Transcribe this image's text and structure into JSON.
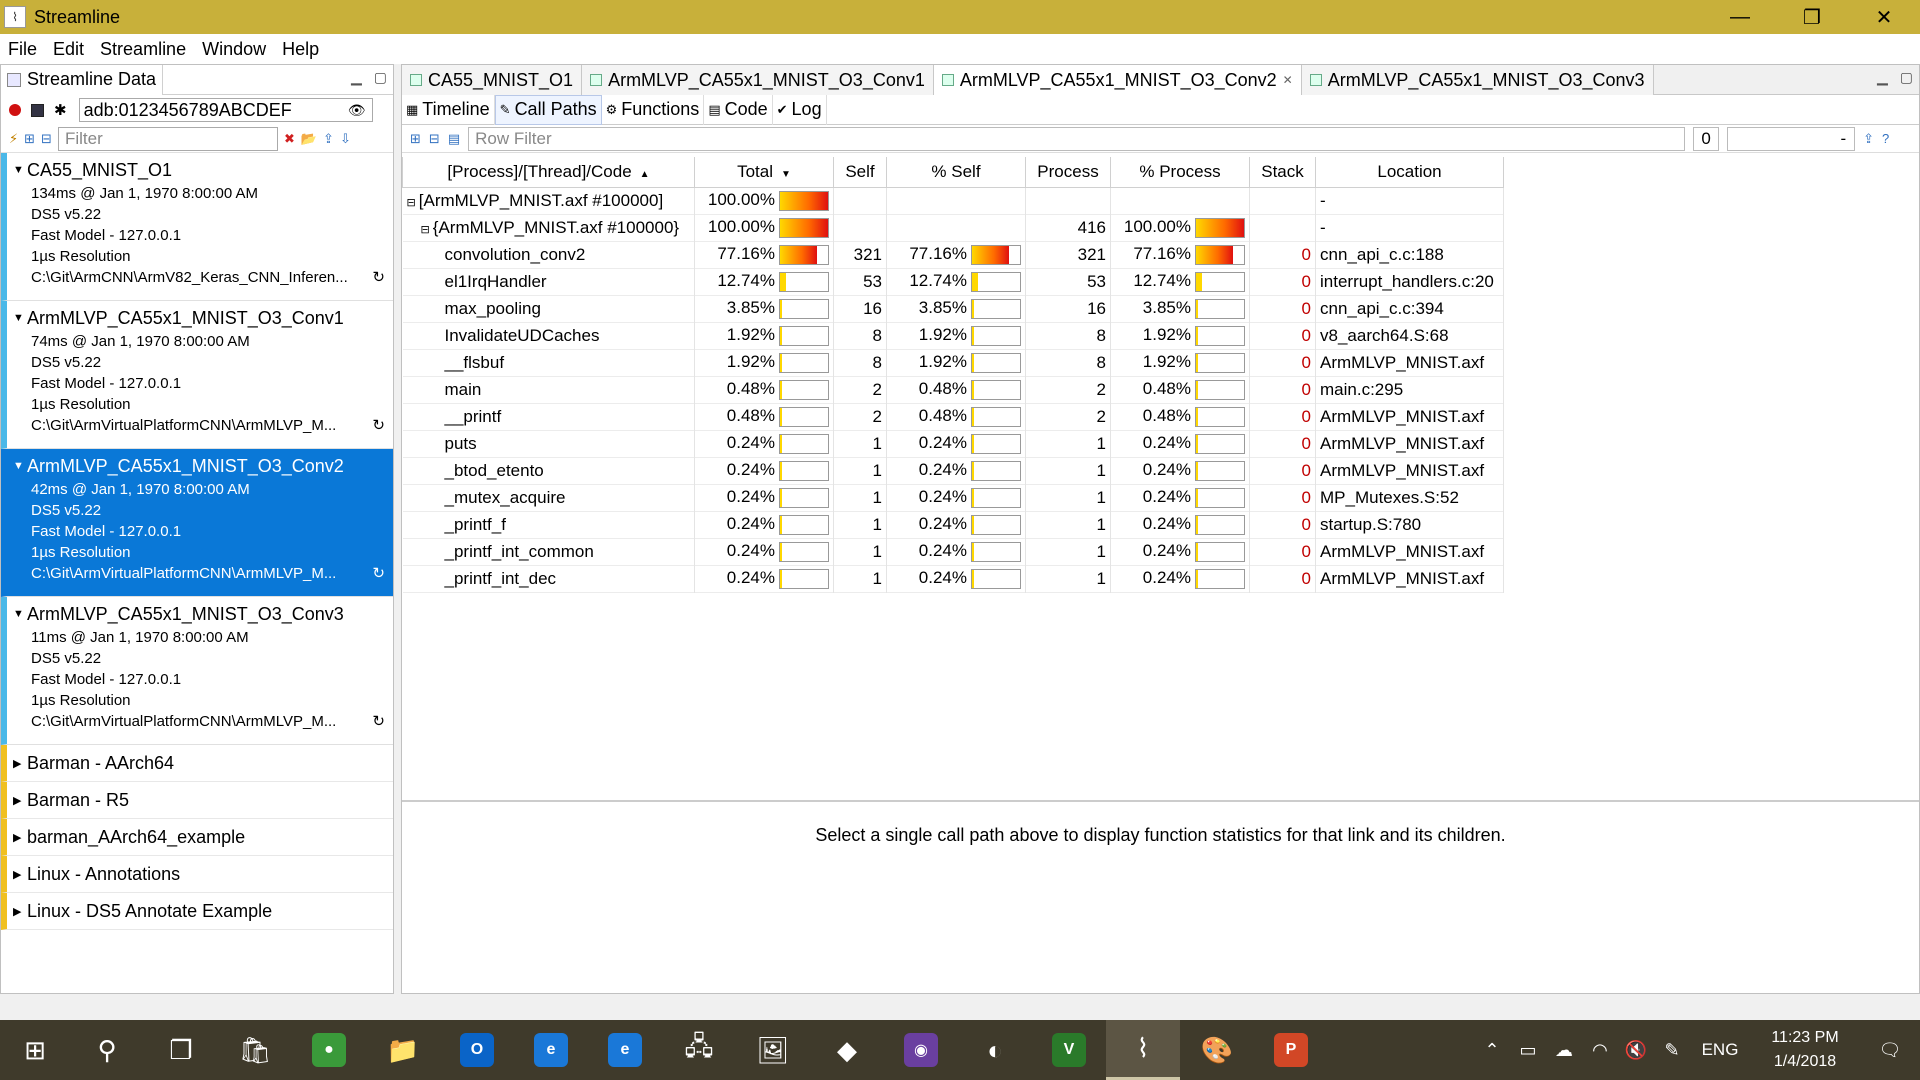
{
  "window": {
    "title": "Streamline",
    "minimize_glyph": "—",
    "maximize_glyph": "❐",
    "close_glyph": "✕"
  },
  "menu": [
    "File",
    "Edit",
    "Streamline",
    "Window",
    "Help"
  ],
  "left_panel": {
    "tab_label": "Streamline Data",
    "device": "adb:0123456789ABCDEF",
    "filter_placeholder": "Filter",
    "captures": [
      {
        "title": "CA55_MNIST_O1",
        "duration": "134ms @ Jan 1, 1970 8:00:00 AM",
        "version": "DS5 v5.22",
        "target": "Fast Model - 127.0.0.1",
        "resolution": "1µs Resolution",
        "path": "C:\\Git\\ArmCNN\\ArmV82_Keras_CNN_Inferen...",
        "selected": false
      },
      {
        "title": "ArmMLVP_CA55x1_MNIST_O3_Conv1",
        "duration": "74ms @ Jan 1, 1970 8:00:00 AM",
        "version": "DS5 v5.22",
        "target": "Fast Model - 127.0.0.1",
        "resolution": "1µs Resolution",
        "path": "C:\\Git\\ArmVirtualPlatformCNN\\ArmMLVP_M...",
        "selected": false
      },
      {
        "title": "ArmMLVP_CA55x1_MNIST_O3_Conv2",
        "duration": "42ms @ Jan 1, 1970 8:00:00 AM",
        "version": "DS5 v5.22",
        "target": "Fast Model - 127.0.0.1",
        "resolution": "1µs Resolution",
        "path": "C:\\Git\\ArmVirtualPlatformCNN\\ArmMLVP_M...",
        "selected": true
      },
      {
        "title": "ArmMLVP_CA55x1_MNIST_O3_Conv3",
        "duration": "11ms @ Jan 1, 1970 8:00:00 AM",
        "version": "DS5 v5.22",
        "target": "Fast Model - 127.0.0.1",
        "resolution": "1µs Resolution",
        "path": "C:\\Git\\ArmVirtualPlatformCNN\\ArmMLVP_M...",
        "selected": false
      }
    ],
    "groups": [
      "Barman - AArch64",
      "Barman - R5",
      "barman_AArch64_example",
      "Linux - Annotations",
      "Linux - DS5 Annotate Example"
    ]
  },
  "doc_tabs": [
    {
      "label": "CA55_MNIST_O1",
      "active": false
    },
    {
      "label": "ArmMLVP_CA55x1_MNIST_O3_Conv1",
      "active": false
    },
    {
      "label": "ArmMLVP_CA55x1_MNIST_O3_Conv2",
      "active": true
    },
    {
      "label": "ArmMLVP_CA55x1_MNIST_O3_Conv3",
      "active": false
    }
  ],
  "view_tabs": [
    {
      "label": "Timeline",
      "active": false
    },
    {
      "label": "Call Paths",
      "active": true
    },
    {
      "label": "Functions",
      "active": false
    },
    {
      "label": "Code",
      "active": false
    },
    {
      "label": "Log",
      "active": false
    }
  ],
  "row_filter_placeholder": "Row Filter",
  "row_filter_count": "0",
  "row_filter_dropdown": "-",
  "table": {
    "headers": [
      "[Process]/[Thread]/Code",
      "Total",
      "Self",
      "% Self",
      "Process",
      "% Process",
      "Stack",
      "Location"
    ],
    "rows": [
      {
        "name": "[ArmMLVP_MNIST.axf #100000]",
        "indent": 0,
        "expander": "⊟",
        "total": "100.00%",
        "total_frac": 1.0,
        "self": "",
        "pself": "",
        "pself_frac": null,
        "process": "",
        "pprocess": "",
        "pprocess_frac": null,
        "stack": "",
        "location": "-"
      },
      {
        "name": "{ArmMLVP_MNIST.axf #100000}",
        "indent": 1,
        "expander": "⊟",
        "total": "100.00%",
        "total_frac": 1.0,
        "self": "",
        "pself": "",
        "pself_frac": null,
        "process": "416",
        "pprocess": "100.00%",
        "pprocess_frac": 1.0,
        "stack": "",
        "location": "-"
      },
      {
        "name": "convolution_conv2",
        "indent": 2,
        "expander": "",
        "total": "77.16%",
        "total_frac": 0.7716,
        "self": "321",
        "pself": "77.16%",
        "pself_frac": 0.7716,
        "process": "321",
        "pprocess": "77.16%",
        "pprocess_frac": 0.7716,
        "stack": "0",
        "location": "cnn_api_c.c:188"
      },
      {
        "name": "el1IrqHandler",
        "indent": 2,
        "expander": "",
        "total": "12.74%",
        "total_frac": 0.1274,
        "self": "53",
        "pself": "12.74%",
        "pself_frac": 0.1274,
        "process": "53",
        "pprocess": "12.74%",
        "pprocess_frac": 0.1274,
        "stack": "0",
        "location": "interrupt_handlers.c:20"
      },
      {
        "name": "max_pooling",
        "indent": 2,
        "expander": "",
        "total": "3.85%",
        "total_frac": 0.0385,
        "self": "16",
        "pself": "3.85%",
        "pself_frac": 0.0385,
        "process": "16",
        "pprocess": "3.85%",
        "pprocess_frac": 0.0385,
        "stack": "0",
        "location": "cnn_api_c.c:394"
      },
      {
        "name": "InvalidateUDCaches",
        "indent": 2,
        "expander": "",
        "total": "1.92%",
        "total_frac": 0.0192,
        "self": "8",
        "pself": "1.92%",
        "pself_frac": 0.0192,
        "process": "8",
        "pprocess": "1.92%",
        "pprocess_frac": 0.0192,
        "stack": "0",
        "location": "v8_aarch64.S:68"
      },
      {
        "name": "__flsbuf",
        "indent": 2,
        "expander": "",
        "total": "1.92%",
        "total_frac": 0.0192,
        "self": "8",
        "pself": "1.92%",
        "pself_frac": 0.0192,
        "process": "8",
        "pprocess": "1.92%",
        "pprocess_frac": 0.0192,
        "stack": "0",
        "location": "ArmMLVP_MNIST.axf"
      },
      {
        "name": "main",
        "indent": 2,
        "expander": "",
        "total": "0.48%",
        "total_frac": 0.0048,
        "self": "2",
        "pself": "0.48%",
        "pself_frac": 0.0048,
        "process": "2",
        "pprocess": "0.48%",
        "pprocess_frac": 0.0048,
        "stack": "0",
        "location": "main.c:295"
      },
      {
        "name": "__printf",
        "indent": 2,
        "expander": "",
        "total": "0.48%",
        "total_frac": 0.0048,
        "self": "2",
        "pself": "0.48%",
        "pself_frac": 0.0048,
        "process": "2",
        "pprocess": "0.48%",
        "pprocess_frac": 0.0048,
        "stack": "0",
        "location": "ArmMLVP_MNIST.axf"
      },
      {
        "name": "puts",
        "indent": 2,
        "expander": "",
        "total": "0.24%",
        "total_frac": 0.0024,
        "self": "1",
        "pself": "0.24%",
        "pself_frac": 0.0024,
        "process": "1",
        "pprocess": "0.24%",
        "pprocess_frac": 0.0024,
        "stack": "0",
        "location": "ArmMLVP_MNIST.axf"
      },
      {
        "name": "_btod_etento",
        "indent": 2,
        "expander": "",
        "total": "0.24%",
        "total_frac": 0.0024,
        "self": "1",
        "pself": "0.24%",
        "pself_frac": 0.0024,
        "process": "1",
        "pprocess": "0.24%",
        "pprocess_frac": 0.0024,
        "stack": "0",
        "location": "ArmMLVP_MNIST.axf"
      },
      {
        "name": "_mutex_acquire",
        "indent": 2,
        "expander": "",
        "total": "0.24%",
        "total_frac": 0.0024,
        "self": "1",
        "pself": "0.24%",
        "pself_frac": 0.0024,
        "process": "1",
        "pprocess": "0.24%",
        "pprocess_frac": 0.0024,
        "stack": "0",
        "location": "MP_Mutexes.S:52"
      },
      {
        "name": "_printf_f",
        "indent": 2,
        "expander": "",
        "total": "0.24%",
        "total_frac": 0.0024,
        "self": "1",
        "pself": "0.24%",
        "pself_frac": 0.0024,
        "process": "1",
        "pprocess": "0.24%",
        "pprocess_frac": 0.0024,
        "stack": "0",
        "location": "startup.S:780"
      },
      {
        "name": "_printf_int_common",
        "indent": 2,
        "expander": "",
        "total": "0.24%",
        "total_frac": 0.0024,
        "self": "1",
        "pself": "0.24%",
        "pself_frac": 0.0024,
        "process": "1",
        "pprocess": "0.24%",
        "pprocess_frac": 0.0024,
        "stack": "0",
        "location": "ArmMLVP_MNIST.axf"
      },
      {
        "name": "_printf_int_dec",
        "indent": 2,
        "expander": "",
        "total": "0.24%",
        "total_frac": 0.0024,
        "self": "1",
        "pself": "0.24%",
        "pself_frac": 0.0024,
        "process": "1",
        "pprocess": "0.24%",
        "pprocess_frac": 0.0024,
        "stack": "0",
        "location": "ArmMLVP_MNIST.axf"
      }
    ]
  },
  "detail_message": "Select a single call path above to display function statistics for that link and its children.",
  "taskbar": {
    "apps": [
      {
        "name": "start-icon",
        "glyph": "⊞"
      },
      {
        "name": "search-icon",
        "glyph": "⚲"
      },
      {
        "name": "task-view-icon",
        "glyph": "❐"
      },
      {
        "name": "store-icon",
        "glyph": "🛍"
      },
      {
        "name": "chrome-icon",
        "glyph": "●"
      },
      {
        "name": "file-explorer-icon",
        "glyph": "📁"
      },
      {
        "name": "outlook-icon",
        "glyph": "O"
      },
      {
        "name": "ie-icon",
        "glyph": "e"
      },
      {
        "name": "edge-icon",
        "glyph": "e"
      },
      {
        "name": "network-tool-icon",
        "glyph": "🖧"
      },
      {
        "name": "image-viewer-icon",
        "glyph": "🖼"
      },
      {
        "name": "git-icon",
        "glyph": "◆"
      },
      {
        "name": "github-icon",
        "glyph": "◉"
      },
      {
        "name": "eclipse-icon",
        "glyph": "◐"
      },
      {
        "name": "vim-icon",
        "glyph": "V"
      },
      {
        "name": "streamline-icon",
        "glyph": "⌇"
      },
      {
        "name": "paint-icon",
        "glyph": "🎨"
      },
      {
        "name": "powerpoint-icon",
        "glyph": "P"
      }
    ],
    "active_app": "streamline-icon",
    "language": "ENG",
    "time": "11:23 PM",
    "date": "1/4/2018"
  },
  "colors": {
    "titlebar": "#c8b03a",
    "selection": "#0a78d7",
    "capture_stripe": "#4ab8e8",
    "group_stripe": "#f0c020",
    "stack_red": "#c00000",
    "taskbar": "#3f3a2b"
  }
}
